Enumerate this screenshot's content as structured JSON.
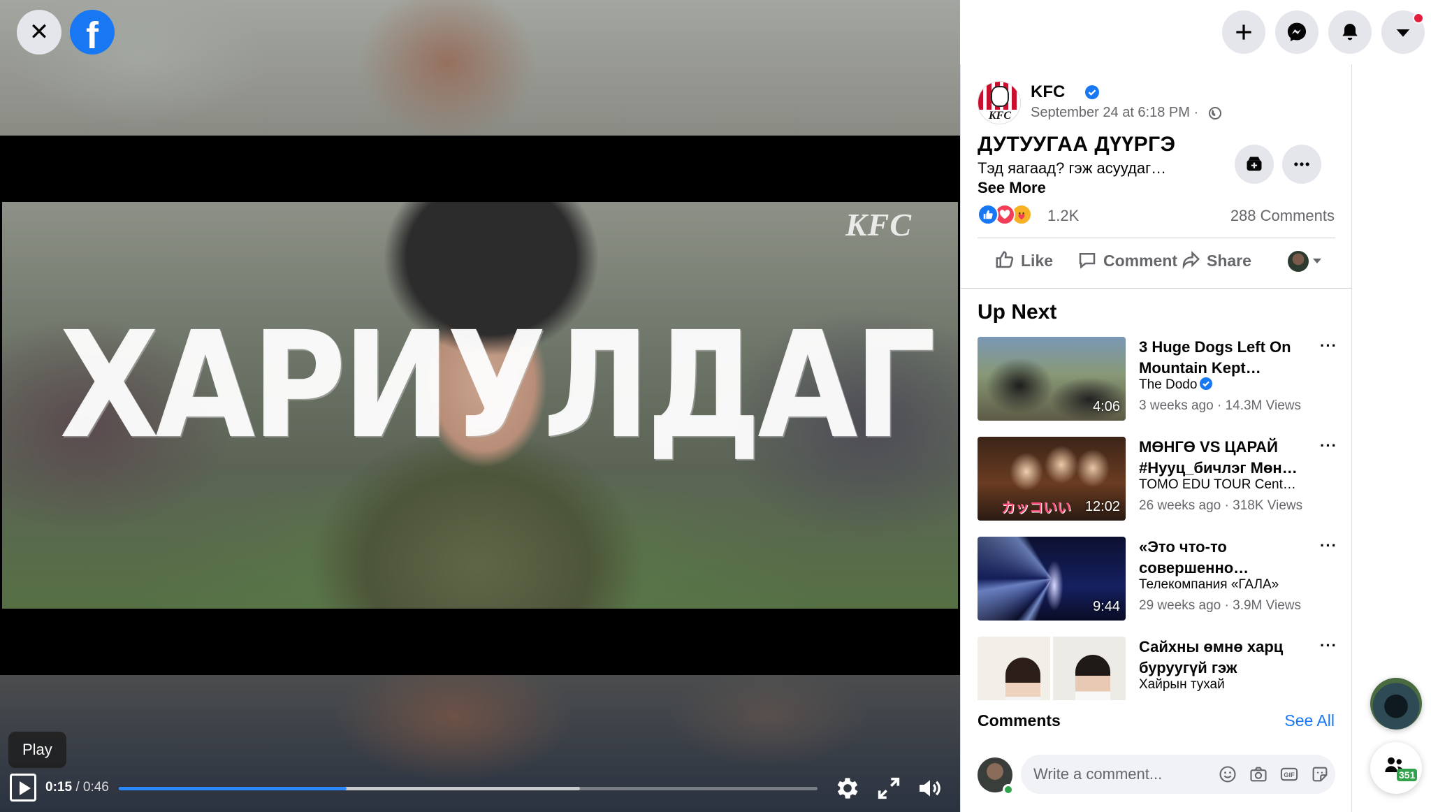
{
  "video": {
    "watermark": "KFC",
    "overlay_text": "ХАРИУЛДАГ",
    "tooltip": "Play",
    "current_time": "0:15",
    "duration": "0:46",
    "progress_fraction": 0.326,
    "buffered_fraction": 0.66
  },
  "icons": {
    "close": "close-icon",
    "facebook": "facebook-logo-icon",
    "play": "play-icon",
    "settings": "gear-icon",
    "fullscreen": "fullscreen-icon",
    "volume": "volume-icon"
  },
  "header": {
    "create": "plus-icon",
    "messenger": "messenger-icon",
    "notifications": "bell-icon",
    "account": "caret-down-icon"
  },
  "post": {
    "page_name": "KFC",
    "date": "September 24 at 6:18 PM ·",
    "title": "ДУТУУГАА ДҮҮРГЭ",
    "body": "Тэд яагаад? гэж асуудаг…",
    "see_more": "See More",
    "reaction_count": "1.2K",
    "comment_count": "288 Comments",
    "actions": {
      "like": "Like",
      "comment": "Comment",
      "share": "Share"
    }
  },
  "up_next": {
    "title": "Up Next",
    "items": [
      {
        "title": "3 Huge Dogs Left On Mountain Kept…",
        "channel": "The Dodo",
        "verified": true,
        "meta": "3 weeks ago · 14.3M Views",
        "duration": "4:06"
      },
      {
        "title": "МӨНГӨ VS ЦАРАЙ #Нууц_бичлэг Мөн…",
        "channel": "TOMO EDU TOUR Cent…",
        "verified": false,
        "meta": "26 weeks ago · 318K Views",
        "duration": "12:02",
        "thumb_text": "カッコいい"
      },
      {
        "title": "«Это что-то совершенно…",
        "channel": "Телекомпания «ГАЛА»",
        "verified": false,
        "meta": "29 weeks ago · 3.9M Views",
        "duration": "9:44"
      },
      {
        "title": "Сайхны өмнө харц буруугүй гэж",
        "channel": "Хайрын тухай",
        "verified": false,
        "meta": "",
        "duration": ""
      }
    ]
  },
  "comments": {
    "title": "Comments",
    "see_all": "See All",
    "placeholder": "Write a comment..."
  },
  "contacts": {
    "count": "351"
  },
  "colors": {
    "brand_blue": "#1877f2",
    "progress": "#2d88ff",
    "online": "#31a24c",
    "notification_dot": "#e41e3f"
  }
}
